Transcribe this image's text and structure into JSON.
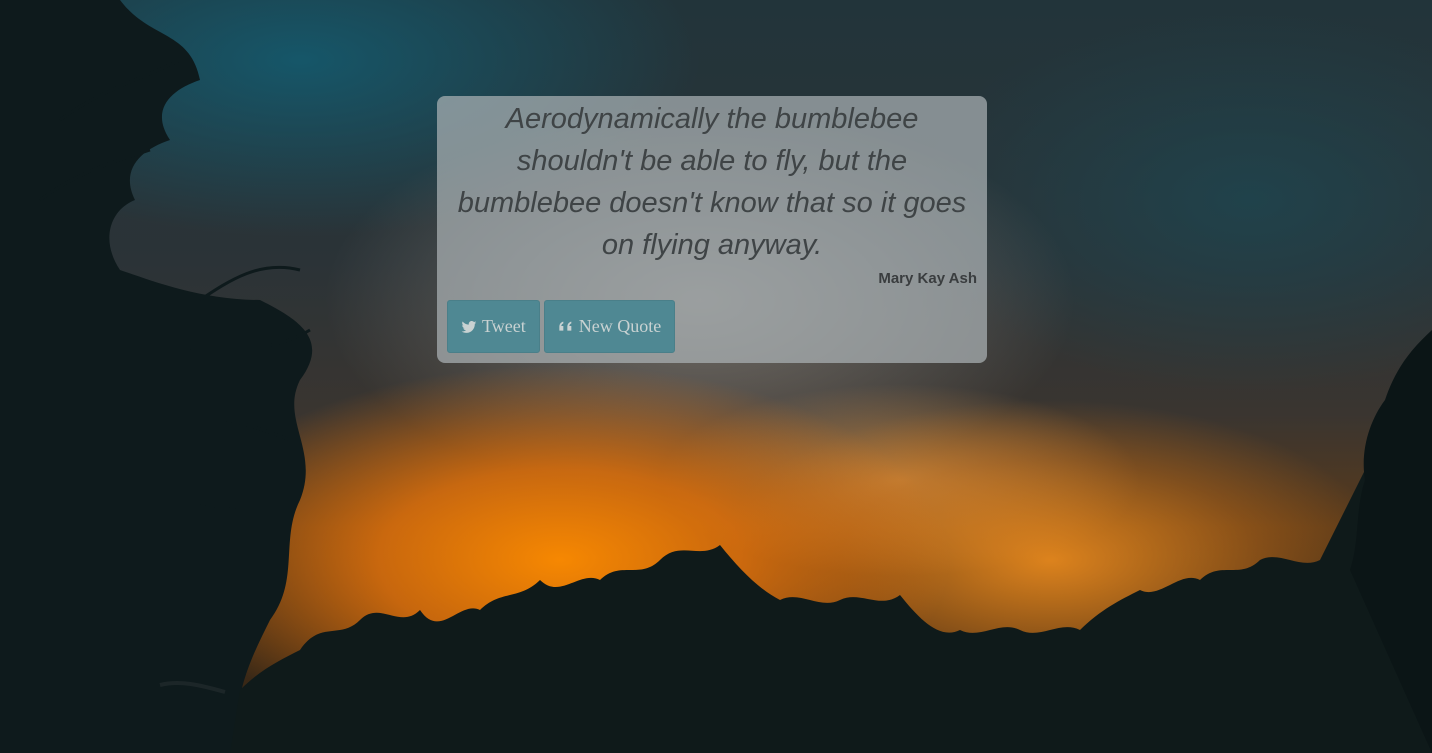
{
  "quote": {
    "text": "Aerodynamically the bumblebee shouldn't be able to fly, but the bumblebee doesn't know that so it goes on flying anyway.",
    "author": "Mary Kay Ash"
  },
  "actions": {
    "tweet_label": "Tweet",
    "tweet_icon": "twitter-icon",
    "new_quote_label": "New Quote",
    "new_quote_icon": "quote-left-icon"
  },
  "colors": {
    "button": "#4f8893",
    "card": "#aab2b4",
    "text": "#3f4446"
  }
}
